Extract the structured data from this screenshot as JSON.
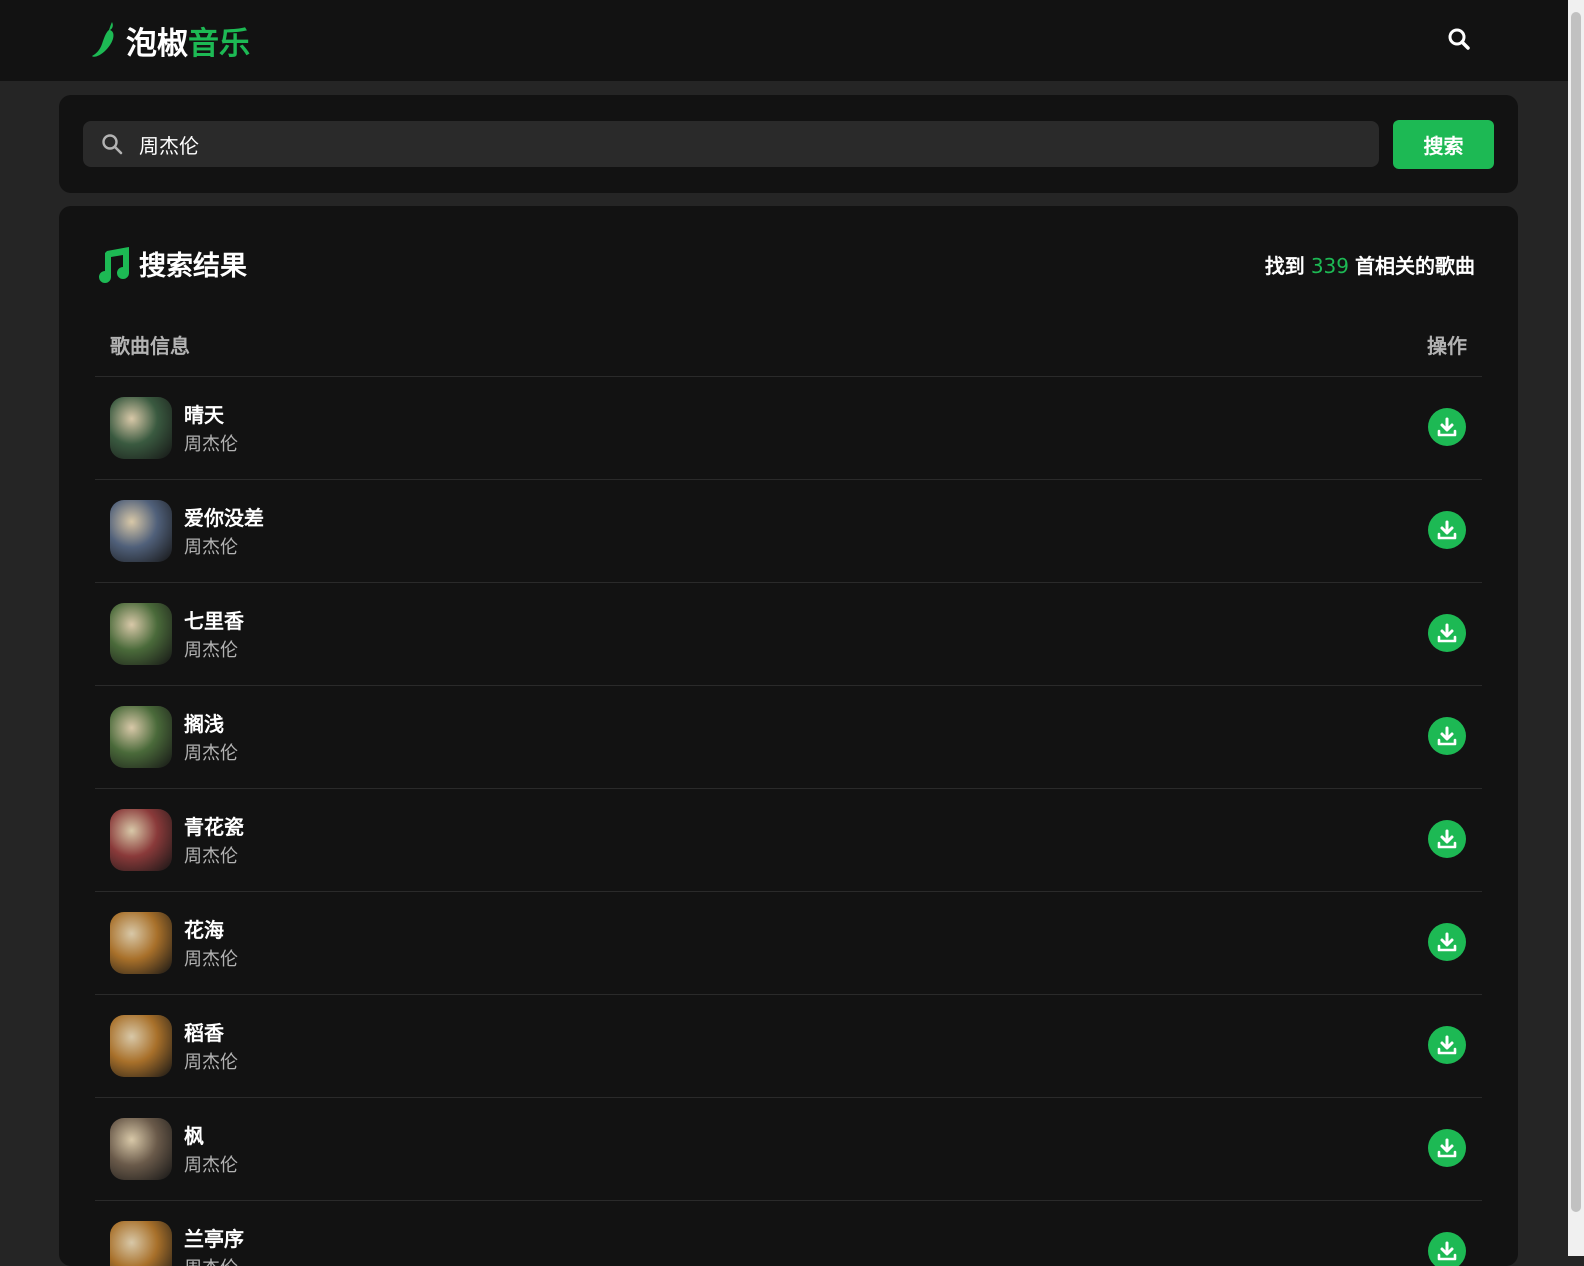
{
  "header": {
    "logo_part1": "泡椒",
    "logo_part2": "音乐",
    "search_icon": "search-icon"
  },
  "search": {
    "value": "周杰伦",
    "button_label": "搜索",
    "icon": "search-icon"
  },
  "results": {
    "title": "搜索结果",
    "count_prefix": "找到",
    "count": "339",
    "count_suffix": "首相关的歌曲",
    "col_song": "歌曲信息",
    "col_action": "操作",
    "songs": [
      {
        "name": "晴天",
        "artist": "周杰伦",
        "cover_color": "#3a5a40"
      },
      {
        "name": "爱你没差",
        "artist": "周杰伦",
        "cover_color": "#50607a"
      },
      {
        "name": "七里香",
        "artist": "周杰伦",
        "cover_color": "#4a6a3a"
      },
      {
        "name": "搁浅",
        "artist": "周杰伦",
        "cover_color": "#4a6a3a"
      },
      {
        "name": "青花瓷",
        "artist": "周杰伦",
        "cover_color": "#8a3a3a"
      },
      {
        "name": "花海",
        "artist": "周杰伦",
        "cover_color": "#a8702a"
      },
      {
        "name": "稻香",
        "artist": "周杰伦",
        "cover_color": "#a8702a"
      },
      {
        "name": "枫",
        "artist": "周杰伦",
        "cover_color": "#6a5a4a"
      },
      {
        "name": "兰亭序",
        "artist": "周杰伦",
        "cover_color": "#a8702a"
      }
    ]
  },
  "colors": {
    "accent": "#1db954",
    "background": "#252525",
    "card": "#121212"
  }
}
